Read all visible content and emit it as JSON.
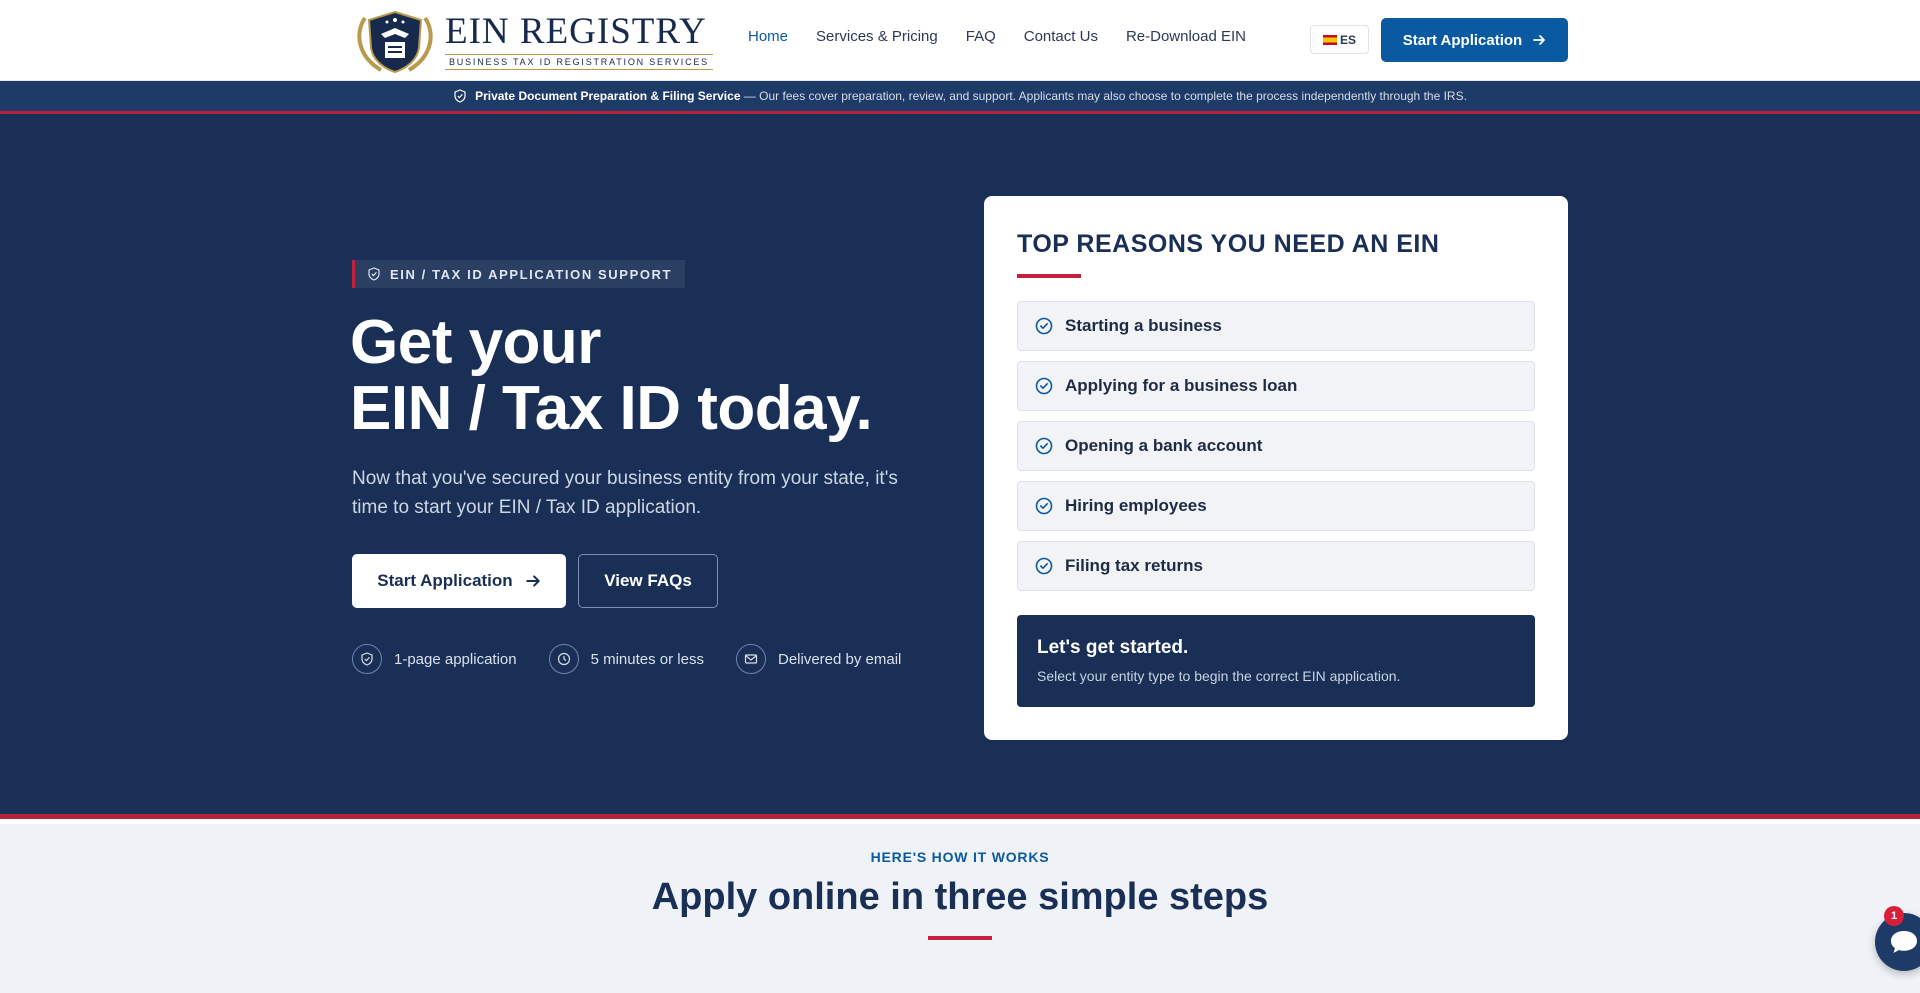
{
  "header": {
    "brand_name": "EIN REGISTRY",
    "brand_tagline": "BUSINESS TAX ID REGISTRATION SERVICES",
    "nav": [
      {
        "label": "Home",
        "active": true
      },
      {
        "label": "Services & Pricing"
      },
      {
        "label": "FAQ"
      },
      {
        "label": "Contact Us"
      },
      {
        "label": "Re-Download EIN"
      }
    ],
    "language": "ES",
    "cta_label": "Start Application"
  },
  "notice": {
    "bold": "Private Document Preparation & Filing Service",
    "text": "— Our fees cover preparation, review, and support. Applicants may also choose to complete the process independently through the IRS."
  },
  "hero": {
    "eyebrow": "EIN / TAX ID APPLICATION SUPPORT",
    "title_line1": "Get your",
    "title_line2": "EIN / Tax ID today.",
    "subtitle": "Now that you've secured your business entity from your state, it's time to start your EIN / Tax ID application.",
    "primary_button": "Start Application",
    "secondary_button": "View FAQs",
    "features": [
      {
        "icon": "shield-icon",
        "label": "1-page application"
      },
      {
        "icon": "clock-icon",
        "label": "5 minutes or less"
      },
      {
        "icon": "mail-icon",
        "label": "Delivered by email"
      }
    ]
  },
  "card": {
    "title": "TOP REASONS YOU NEED AN EIN",
    "reasons": [
      "Starting a business",
      "Applying for a business loan",
      "Opening a bank account",
      "Hiring employees",
      "Filing tax returns"
    ],
    "cta_title": "Let's get started.",
    "cta_text": "Select your entity type to begin the correct EIN application."
  },
  "how": {
    "eyebrow": "HERE'S HOW IT WORKS",
    "title": "Apply online in three simple steps"
  },
  "chat": {
    "badge": "1"
  },
  "colors": {
    "navy": "#1a2f55",
    "accent_red": "#c4213f",
    "primary_blue": "#0a5aa2",
    "gold": "#b89a4e"
  }
}
